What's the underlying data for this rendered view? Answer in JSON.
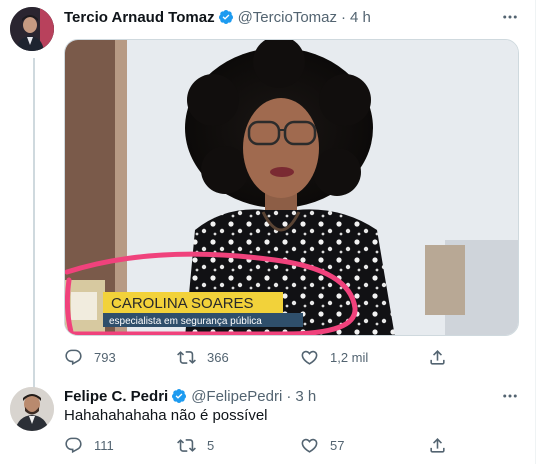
{
  "tweet1": {
    "display_name": "Tercio Arnaud Tomaz",
    "handle": "@TercioTomaz",
    "separator": "·",
    "time": "4 h",
    "media": {
      "lower_third_name": "CAROLINA SOARES",
      "lower_third_title": "especialista em segurança pública",
      "highlight_color": "#f0427c"
    },
    "actions": {
      "replies": "793",
      "retweets": "366",
      "likes": "1,2 mil"
    }
  },
  "tweet2": {
    "display_name": "Felipe C. Pedri",
    "handle": "@FelipePedri",
    "separator": "·",
    "time": "3 h",
    "text": "Hahahahahaha não é possível",
    "actions": {
      "replies": "111",
      "retweets": "5",
      "likes": "57"
    }
  },
  "colors": {
    "verified": "#1d9bf0",
    "secondary_text": "#536471",
    "thread_line": "#cfd9de"
  },
  "icons": [
    "more-icon",
    "verified-icon",
    "reply-icon",
    "retweet-icon",
    "like-icon",
    "share-icon"
  ]
}
